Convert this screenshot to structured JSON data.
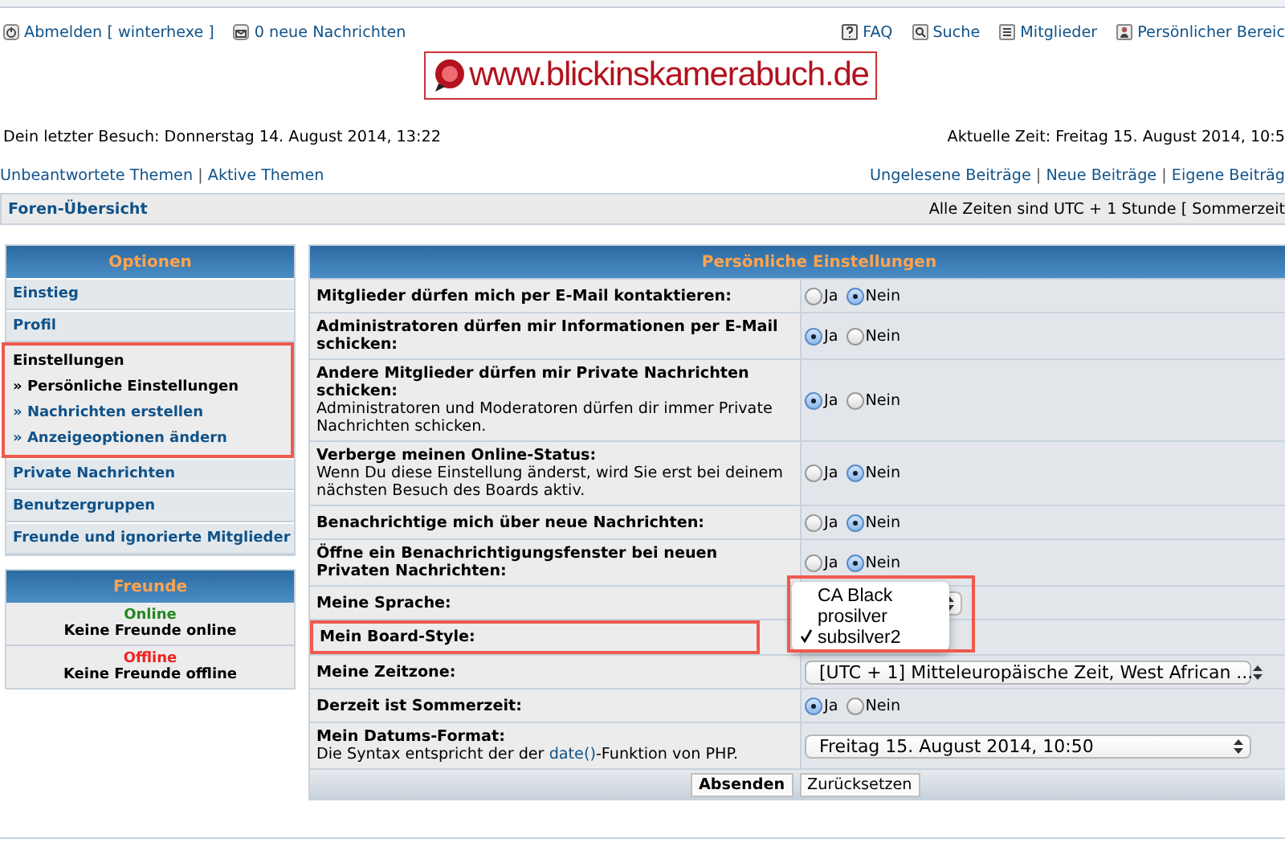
{
  "top_left": [
    "Abmelden [ winterhexe ]",
    "0 neue Nachrichten"
  ],
  "top_right": [
    "FAQ",
    "Suche",
    "Mitglieder",
    "Persönlicher Bereic"
  ],
  "logo": {
    "text": "www.blickinskamerabuch.de"
  },
  "last_visit": "Dein letzter Besuch: Donnerstag 14. August 2014, 13:22",
  "current_time": "Aktuelle Zeit: Freitag 15. August 2014, 10:5",
  "link_separator": "|",
  "links_left": [
    "Unbeantwortete Themen",
    "Aktive Themen"
  ],
  "links_right": [
    "Ungelesene Beiträge",
    "Neue Beiträge",
    "Eigene Beiträg"
  ],
  "breadcrumb": "Foren-Übersicht",
  "timezone_note": "Alle Zeiten sind UTC + 1 Stunde [ Sommerzeit",
  "sidebar": {
    "title": "Optionen",
    "items": [
      {
        "label": "Einstieg",
        "selected": false
      },
      {
        "label": "Profil",
        "selected": false
      },
      {
        "label": "Einstellungen",
        "selected": true,
        "highlighted": true,
        "children": [
          {
            "label": "» Persönliche Einstellungen",
            "selected": true
          },
          {
            "label": "» Nachrichten erstellen",
            "selected": false
          },
          {
            "label": "» Anzeigeoptionen ändern",
            "selected": false
          }
        ]
      },
      {
        "label": "Private Nachrichten",
        "selected": false
      },
      {
        "label": "Benutzergruppen",
        "selected": false
      },
      {
        "label": "Freunde und ignorierte Mitglieder",
        "selected": false
      }
    ]
  },
  "friends": {
    "title": "Freunde",
    "groups": [
      {
        "status": "Online",
        "color": "#228822",
        "text": "Keine Freunde online"
      },
      {
        "status": "Offline",
        "color": "#ee2222",
        "text": "Keine Freunde offline"
      }
    ]
  },
  "settings": {
    "title": "Persönliche Einstellungen",
    "rows": [
      {
        "kind": "radio",
        "label": "Mitglieder dürfen mich per E-Mail kontaktieren:",
        "options": [
          {
            "label": "Ja",
            "selected": false
          },
          {
            "label": "Nein",
            "selected": true
          }
        ]
      },
      {
        "kind": "radio",
        "label": "Administratoren dürfen mir Informationen per E-Mail schicken:",
        "options": [
          {
            "label": "Ja",
            "selected": true
          },
          {
            "label": "Nein",
            "selected": false
          }
        ]
      },
      {
        "kind": "radio",
        "label": "Andere Mitglieder dürfen mir Private Nachrichten schicken:",
        "description": "Administratoren und Moderatoren dürfen dir immer Private Nachrichten schicken.",
        "options": [
          {
            "label": "Ja",
            "selected": true
          },
          {
            "label": "Nein",
            "selected": false
          }
        ]
      },
      {
        "kind": "radio",
        "label": "Verberge meinen Online-Status:",
        "description": "Wenn Du diese Einstellung änderst, wird Sie erst bei deinem nächsten Besuch des Boards aktiv.",
        "options": [
          {
            "label": "Ja",
            "selected": false
          },
          {
            "label": "Nein",
            "selected": true
          }
        ]
      },
      {
        "kind": "radio",
        "label": "Benachrichtige mich über neue Nachrichten:",
        "options": [
          {
            "label": "Ja",
            "selected": false
          },
          {
            "label": "Nein",
            "selected": true
          }
        ]
      },
      {
        "kind": "radio",
        "label": "Öffne ein Benachrichtigungsfenster bei neuen Privaten Nachrichten:",
        "options": [
          {
            "label": "Ja",
            "selected": false
          },
          {
            "label": "Nein",
            "selected": true
          }
        ]
      },
      {
        "kind": "select",
        "label": "Meine Sprache:"
      },
      {
        "kind": "menu",
        "label": "Mein Board-Style:",
        "highlighted": true,
        "options": [
          {
            "label": "CA Black",
            "selected": false
          },
          {
            "label": "prosilver",
            "selected": false
          },
          {
            "label": "subsilver2",
            "selected": true
          }
        ]
      },
      {
        "kind": "select",
        "label": "Meine Zeitzone:",
        "value": "[UTC + 1] Mitteleuropäische Zeit, West African ..."
      },
      {
        "kind": "radio",
        "label": "Derzeit ist Sommerzeit:",
        "options": [
          {
            "label": "Ja",
            "selected": true
          },
          {
            "label": "Nein",
            "selected": false
          }
        ]
      },
      {
        "kind": "select",
        "label": "Mein Datums-Format:",
        "description": "Die Syntax entspricht der der ",
        "link": "date()",
        "description_end": "-Funktion von PHP.",
        "value": "Freitag 15. August 2014, 10:50"
      }
    ],
    "buttons": [
      "Absenden",
      "Zurücksetzen"
    ]
  }
}
